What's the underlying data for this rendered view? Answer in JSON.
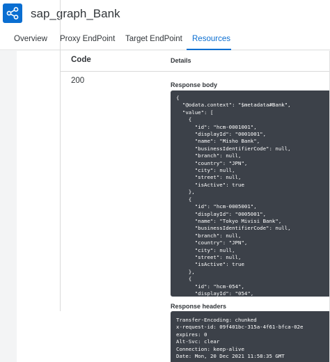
{
  "app": {
    "title": "sap_graph_Bank",
    "icon": "share-icon",
    "accent": "#0a6ed1"
  },
  "tabs": [
    {
      "label": "Overview",
      "active": false
    },
    {
      "label": "Proxy EndPoint",
      "active": false
    },
    {
      "label": "Target EndPoint",
      "active": false
    },
    {
      "label": "Resources",
      "active": true
    }
  ],
  "table": {
    "code_header": "Code",
    "details_header": "Details",
    "row": {
      "code": "200",
      "response_body_label": "Response body",
      "response_body": "{\n  \"@odata.context\": \"$metadata#Bank\",\n  \"value\": [\n    {\n      \"id\": \"hcm-0001001\",\n      \"displayId\": \"0001001\",\n      \"name\": \"Misho Bank\",\n      \"businessIdentifierCode\": null,\n      \"branch\": null,\n      \"country\": \"JPN\",\n      \"city\": null,\n      \"street\": null,\n      \"isActive\": true\n    },\n    {\n      \"id\": \"hcm-0005001\",\n      \"displayId\": \"0005001\",\n      \"name\": \"Tokyo Mivisi Bank\",\n      \"businessIdentifierCode\": null,\n      \"branch\": null,\n      \"country\": \"JPN\",\n      \"city\": null,\n      \"street\": null,\n      \"isActive\": true\n    },\n    {\n      \"id\": \"hcm-054\",\n      \"displayId\": \"054\",",
      "response_headers_label": "Response headers",
      "response_headers": "Transfer-Encoding: chunked\nx-request-id: 09f401bc-315a-4f61-bfca-02e\nexpires: 0\nAlt-Svc: clear\nConnection: keep-alive\nDate: Mon, 20 Dec 2021 11:58:35 GMT"
    }
  }
}
